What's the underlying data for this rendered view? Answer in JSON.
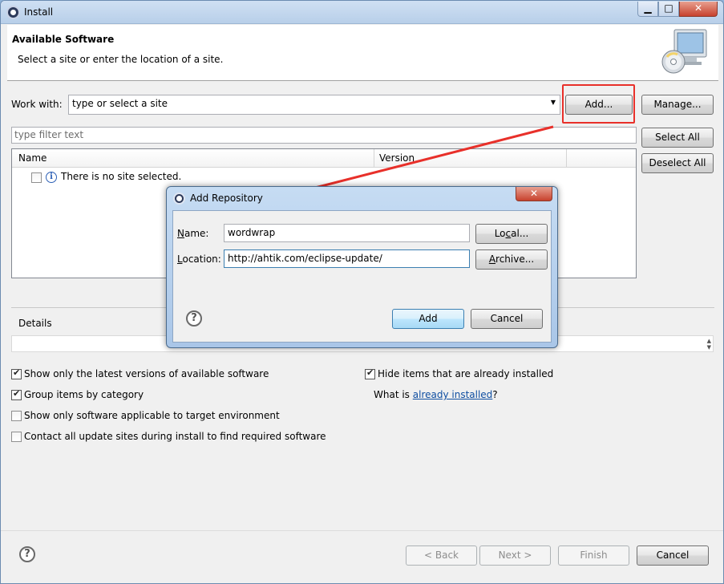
{
  "window": {
    "title": "Install",
    "controls": {
      "minimize": "▁",
      "maximize": "□",
      "close": "✕"
    }
  },
  "header": {
    "title": "Available Software",
    "subtitle": "Select a site or enter the location of a site.",
    "image_icon": "cd-monitor-icon"
  },
  "work_with": {
    "label": "Work with:",
    "value": "type or select a site",
    "add_button": "Add...",
    "manage_button": "Manage..."
  },
  "filter": {
    "placeholder": "type filter text"
  },
  "table": {
    "columns": [
      "Name",
      "Version"
    ],
    "rows": [
      {
        "checked": false,
        "icon": "info-icon",
        "text": "There is no site selected."
      }
    ]
  },
  "side_buttons": {
    "select_all": "Select All",
    "deselect_all": "Deselect All"
  },
  "details": {
    "label": "Details",
    "value": ""
  },
  "options": {
    "show_latest": {
      "label": "Show only the latest versions of available software",
      "checked": true
    },
    "group_by_category": {
      "label": "Group items by category",
      "checked": true
    },
    "show_applicable": {
      "label": "Show only software applicable to target environment",
      "checked": false
    },
    "contact_all_sites": {
      "label": "Contact all update sites during install to find required software",
      "checked": false
    },
    "hide_installed": {
      "label": "Hide items that are already installed",
      "checked": true
    },
    "what_is_prefix": "What is ",
    "what_is_link": "already installed",
    "what_is_suffix": "?"
  },
  "footer": {
    "back": "< Back",
    "next": "Next >",
    "finish": "Finish",
    "cancel": "Cancel"
  },
  "dialog": {
    "title": "Add Repository",
    "close": "✕",
    "name_label_key": "N",
    "name_label_rest": "ame:",
    "name_value": "wordwrap",
    "local_button_a": "Lo",
    "local_button_key": "c",
    "local_button_b": "al...",
    "location_label_key": "L",
    "location_label_rest": "ocation:",
    "location_value": "http://ahtik.com/eclipse-update/",
    "archive_button_key": "A",
    "archive_button_rest": "rchive...",
    "add_button": "Add",
    "cancel_button": "Cancel"
  },
  "annotation": {
    "color": "#e8302a"
  }
}
